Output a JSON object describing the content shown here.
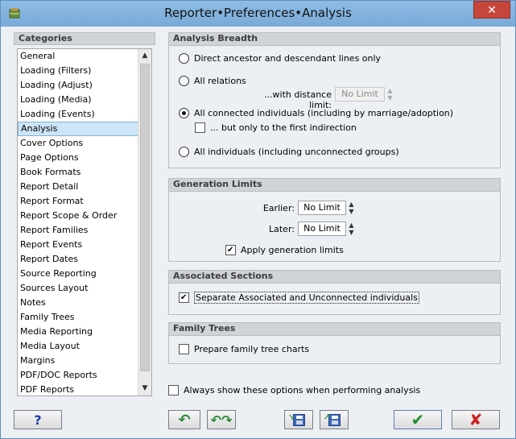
{
  "window": {
    "title": "Reporter•Preferences•Analysis",
    "close_label": "✕"
  },
  "categories": {
    "header": "Categories",
    "items": [
      "General",
      "Loading (Filters)",
      "Loading (Adjust)",
      "Loading (Media)",
      "Loading (Events)",
      "Analysis",
      "Cover Options",
      "Page Options",
      "Book Formats",
      "Report Detail",
      "Report Format",
      "Report Scope & Order",
      "Report Families",
      "Report Events",
      "Report Dates",
      "Source Reporting",
      "Sources Layout",
      "Notes",
      "Family Trees",
      "Media Reporting",
      "Media Layout",
      "Margins",
      "PDF/DOC Reports",
      "PDF Reports"
    ],
    "selected": "Analysis"
  },
  "analysis_breadth": {
    "header": "Analysis Breadth",
    "opt_direct": "Direct ancestor and descendant lines only",
    "opt_all_relations": "All relations",
    "distance_label": "...with distance limit:",
    "distance_value": "No Limit",
    "opt_connected": "All connected individuals (including by marriage/adoption)",
    "first_indirection": "... but only to the first indirection",
    "opt_all_individuals": "All  individuals (including unconnected groups)",
    "selected": "connected"
  },
  "generation_limits": {
    "header": "Generation Limits",
    "earlier_label": "Earlier:",
    "earlier_value": "No Limit",
    "later_label": "Later:",
    "later_value": "No Limit",
    "apply_label": "Apply generation limits",
    "apply_checked": true
  },
  "associated": {
    "header": "Associated Sections",
    "separate_label": "Separate Associated and Unconnected individuals",
    "separate_checked": true
  },
  "family_trees": {
    "header": "Family Trees",
    "prepare_label": "Prepare family tree charts",
    "prepare_checked": false
  },
  "footer": {
    "always_show": "Always show these options when performing analysis",
    "help_label": "?",
    "ok_label": "✔",
    "cancel_label": "✘"
  }
}
